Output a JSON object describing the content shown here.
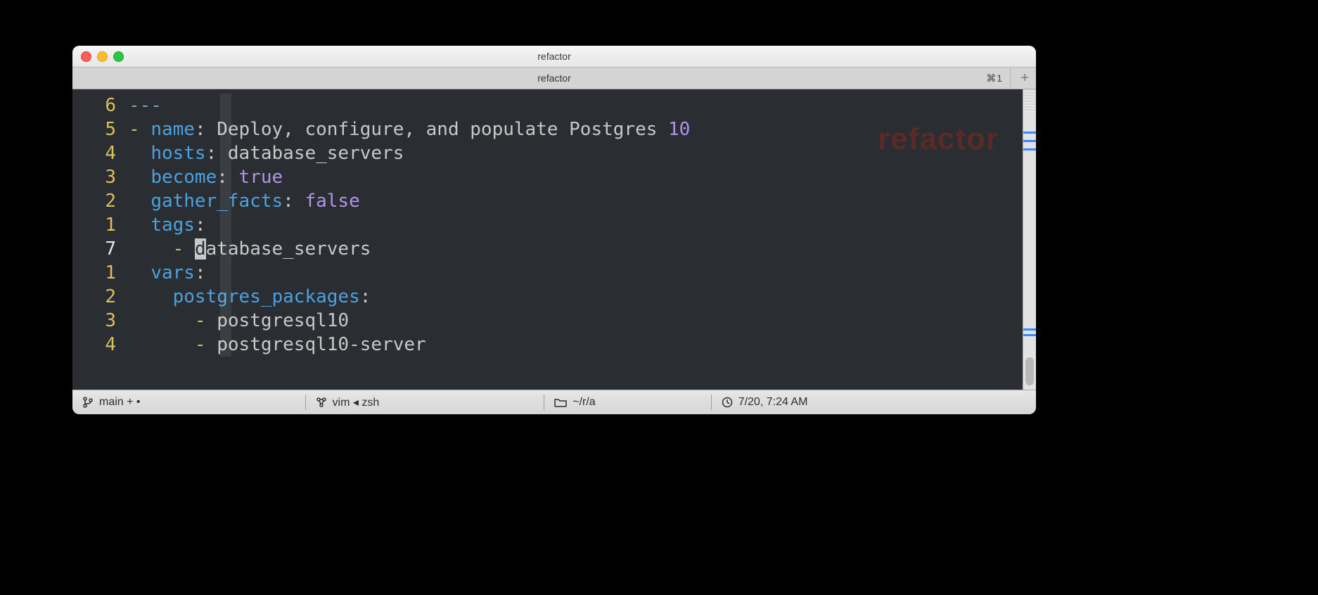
{
  "window": {
    "title": "refactor"
  },
  "tabbar": {
    "active_tab_title": "refactor",
    "shortcut_label": "⌘1",
    "add_label": "+"
  },
  "watermark": "refactor",
  "editor": {
    "cursor_line_index": 6,
    "lines": [
      {
        "num": "6",
        "tokens": [
          {
            "cls": "doc",
            "txt": "---"
          }
        ]
      },
      {
        "num": "5",
        "tokens": [
          {
            "cls": "dash",
            "txt": "- "
          },
          {
            "cls": "kw",
            "txt": "name"
          },
          {
            "cls": "str",
            "txt": ": Deploy, configure, and populate Postgres "
          },
          {
            "cls": "num",
            "txt": "10"
          }
        ]
      },
      {
        "num": "4",
        "tokens": [
          {
            "cls": "str",
            "txt": "  "
          },
          {
            "cls": "kw",
            "txt": "hosts"
          },
          {
            "cls": "str",
            "txt": ": database_servers"
          }
        ]
      },
      {
        "num": "3",
        "tokens": [
          {
            "cls": "str",
            "txt": "  "
          },
          {
            "cls": "kw",
            "txt": "become"
          },
          {
            "cls": "str",
            "txt": ": "
          },
          {
            "cls": "bool",
            "txt": "true"
          }
        ]
      },
      {
        "num": "2",
        "tokens": [
          {
            "cls": "str",
            "txt": "  "
          },
          {
            "cls": "kw",
            "txt": "gather_facts"
          },
          {
            "cls": "str",
            "txt": ": "
          },
          {
            "cls": "bool",
            "txt": "false"
          }
        ]
      },
      {
        "num": "1",
        "tokens": [
          {
            "cls": "str",
            "txt": "  "
          },
          {
            "cls": "kw",
            "txt": "tags"
          },
          {
            "cls": "str",
            "txt": ":"
          }
        ]
      },
      {
        "num": "7",
        "tokens": [
          {
            "cls": "str",
            "txt": "    "
          },
          {
            "cls": "dash",
            "txt": "- "
          },
          {
            "cls": "str",
            "txt": "database_servers"
          }
        ]
      },
      {
        "num": "1",
        "tokens": [
          {
            "cls": "str",
            "txt": "  "
          },
          {
            "cls": "kw",
            "txt": "vars"
          },
          {
            "cls": "str",
            "txt": ":"
          }
        ]
      },
      {
        "num": "2",
        "tokens": [
          {
            "cls": "str",
            "txt": "    "
          },
          {
            "cls": "kw",
            "txt": "postgres_packages"
          },
          {
            "cls": "str",
            "txt": ":"
          }
        ]
      },
      {
        "num": "3",
        "tokens": [
          {
            "cls": "str",
            "txt": "      "
          },
          {
            "cls": "dash",
            "txt": "- "
          },
          {
            "cls": "str",
            "txt": "postgresql10"
          }
        ]
      },
      {
        "num": "4",
        "tokens": [
          {
            "cls": "str",
            "txt": "      "
          },
          {
            "cls": "dash",
            "txt": "- "
          },
          {
            "cls": "str",
            "txt": "postgresql10-server"
          }
        ]
      }
    ]
  },
  "status": {
    "branch": "main + •",
    "process": "vim ◂ zsh",
    "path": "~/r/a",
    "time": "7/20, 7:24 AM"
  },
  "icons": {
    "branch": "branch-icon",
    "node": "node-icon",
    "folder": "folder-icon",
    "clock": "clock-icon"
  }
}
